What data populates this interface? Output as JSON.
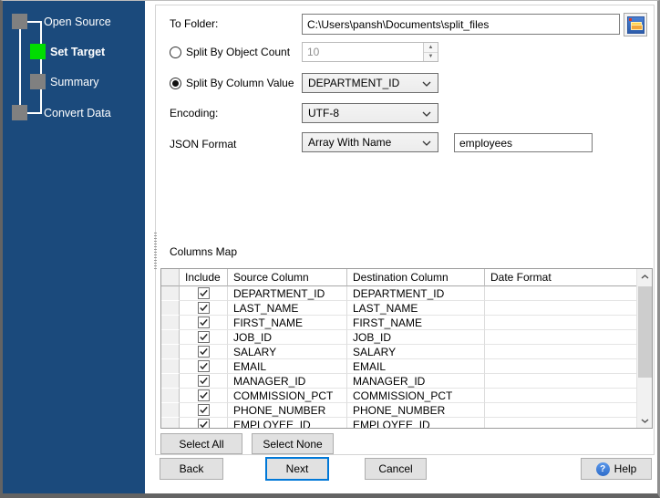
{
  "colors": {
    "sidebar_bg": "#1b4a7c",
    "active_step": "#00dd00",
    "inactive_step": "#808080",
    "accent": "#0078d7",
    "button_bg": "#e1e1e1"
  },
  "sidebar": {
    "steps": [
      {
        "label": "Open Source",
        "state": "done"
      },
      {
        "label": "Set Target",
        "state": "active"
      },
      {
        "label": "Summary",
        "state": "pending"
      },
      {
        "label": "Convert Data",
        "state": "pending"
      }
    ]
  },
  "form": {
    "to_folder_label": "To Folder:",
    "to_folder_value": "C:\\Users\\pansh\\Documents\\split_files",
    "split_by_object_count_label": "Split By Object Count",
    "split_by_object_count_value": "10",
    "split_by_column_value_label": "Split By Column Value",
    "split_by_column_value_selected": "DEPARTMENT_ID",
    "encoding_label": "Encoding:",
    "encoding_value": "UTF-8",
    "json_format_label": "JSON Format",
    "json_format_value": "Array With Name",
    "json_root_name": "employees"
  },
  "columns_map": {
    "title": "Columns Map",
    "headers": [
      "Include",
      "Source Column",
      "Destination Column",
      "Date Format"
    ],
    "rows": [
      {
        "include": true,
        "source": "DEPARTMENT_ID",
        "destination": "DEPARTMENT_ID",
        "date_format": ""
      },
      {
        "include": true,
        "source": "LAST_NAME",
        "destination": "LAST_NAME",
        "date_format": ""
      },
      {
        "include": true,
        "source": "FIRST_NAME",
        "destination": "FIRST_NAME",
        "date_format": ""
      },
      {
        "include": true,
        "source": "JOB_ID",
        "destination": "JOB_ID",
        "date_format": ""
      },
      {
        "include": true,
        "source": "SALARY",
        "destination": "SALARY",
        "date_format": ""
      },
      {
        "include": true,
        "source": "EMAIL",
        "destination": "EMAIL",
        "date_format": ""
      },
      {
        "include": true,
        "source": "MANAGER_ID",
        "destination": "MANAGER_ID",
        "date_format": ""
      },
      {
        "include": true,
        "source": "COMMISSION_PCT",
        "destination": "COMMISSION_PCT",
        "date_format": ""
      },
      {
        "include": true,
        "source": "PHONE_NUMBER",
        "destination": "PHONE_NUMBER",
        "date_format": ""
      },
      {
        "include": true,
        "source": "EMPLOYEE_ID",
        "destination": "EMPLOYEE_ID",
        "date_format": ""
      }
    ],
    "select_all_label": "Select All",
    "select_none_label": "Select None"
  },
  "buttons": {
    "back": "Back",
    "next": "Next",
    "cancel": "Cancel",
    "help": "Help"
  },
  "icons": {
    "help_glyph": "?"
  }
}
